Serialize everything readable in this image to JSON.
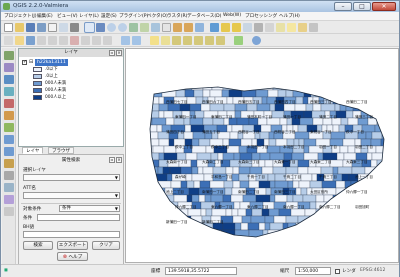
{
  "window": {
    "title": "QGIS 2.2.0-Valmiera",
    "minimize": "–",
    "maximize": "□",
    "close": "✕"
  },
  "menu": [
    "プロジェクト(J)",
    "編集(E)",
    "ビュー(V)",
    "レイヤ(L)",
    "設定(S)",
    "プラグイン(P)",
    "ベクタ(O)",
    "ラスタ(R)",
    "データベース(D)",
    "Web(W)",
    "プロセッシング",
    "ヘルプ(H)"
  ],
  "colors": {
    "accent": "#3d74c7",
    "legend": [
      "#eef3fb",
      "#b7cde8",
      "#6f9bd1",
      "#3c6fb6",
      "#0f3e86"
    ]
  },
  "layers_panel": {
    "title": "レイヤ",
    "layer": {
      "name": "h22ka13111",
      "checked": true
    },
    "legend": [
      ".0以下",
      ".0以上",
      "000人未満",
      "000人未満",
      "000人以上"
    ]
  },
  "tabs": [
    "レイヤ",
    "ブラウザ"
  ],
  "filter": {
    "title": "属性検索",
    "label1": "選択レイヤ",
    "label2": "ATT名",
    "label3": "対象条件",
    "combo3": "条件",
    "label4": "条件",
    "label5": "BH語",
    "btn_search": "検索",
    "btn_export": "エクスポート",
    "btn_clear": "クリア",
    "help": "ヘルプ"
  },
  "map_labels": [
    "西蒲田七丁目",
    "西蒲田六丁目",
    "西蒲田五丁目",
    "西蒲田四丁目",
    "西蒲田三丁目",
    "西蒲田二丁目",
    "東蒲田一丁目",
    "東蒲田二丁目",
    "蒲田本町一丁目",
    "蒲田一丁目",
    "蒲田二丁目",
    "蒲田三丁目",
    "蒲田四丁目",
    "蒲田五丁目",
    "西糀谷一丁目",
    "西糀谷二丁目",
    "東糀谷一丁目",
    "萩中一丁目",
    "萩中二丁目",
    "萩中三丁目",
    "本羽田一丁目",
    "本羽田二丁目",
    "羽田一丁目",
    "羽田二丁目",
    "大森南一丁目",
    "大森南二丁目",
    "大森南三丁目",
    "大森東一丁目",
    "大森東二丁目",
    "大森東三丁目",
    "森が崎",
    "平和島一丁目",
    "千鳥一丁目",
    "千鳥二丁目",
    "千鳥三丁目",
    "池上一丁目",
    "池上二丁目",
    "南蒲田一丁目",
    "南蒲田二丁目",
    "南蒲田三丁目",
    "大田区役所",
    "仲六郷一丁目",
    "仲六郷二丁目",
    "東六郷一丁目",
    "東六郷二丁目",
    "南六郷一丁目",
    "南六郷二丁目",
    "羽田旭町",
    "新蒲田一丁目",
    "新蒲田二丁目"
  ],
  "status": {
    "coord_label": "座標",
    "coord": "139.5918,35.5722",
    "scale_label": "縮尺",
    "scale": "1:50,000",
    "render": "レンダ",
    "epsg": "EPSG:4612"
  }
}
